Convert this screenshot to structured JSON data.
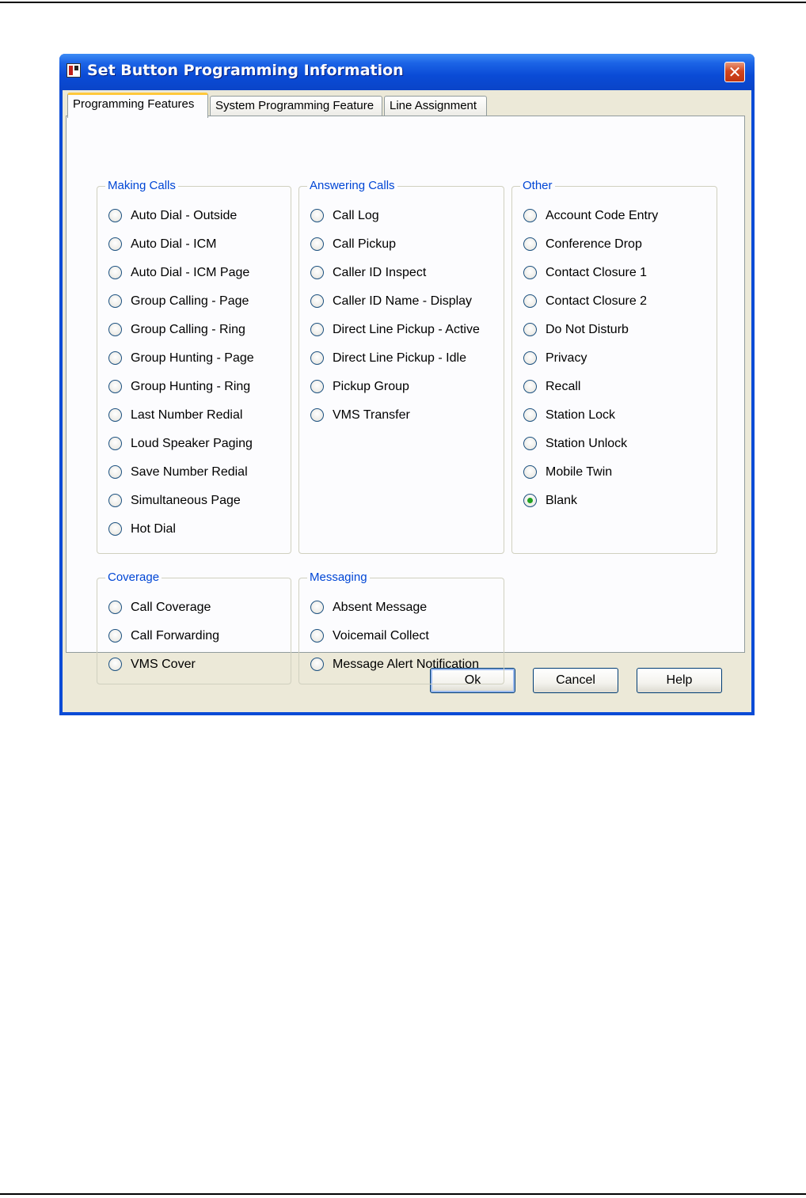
{
  "window": {
    "title": "Set Button Programming Information",
    "close_glyph": "✕"
  },
  "tabs": [
    {
      "label": "Programming Features",
      "selected": true
    },
    {
      "label": "System Programming Feature",
      "selected": false
    },
    {
      "label": "Line Assignment",
      "selected": false
    }
  ],
  "groups": {
    "making_calls": {
      "title": "Making Calls",
      "options": [
        "Auto Dial - Outside",
        "Auto Dial - ICM",
        "Auto Dial - ICM Page",
        "Group Calling - Page",
        "Group Calling - Ring",
        "Group Hunting - Page",
        "Group Hunting - Ring",
        "Last Number Redial",
        "Loud Speaker Paging",
        "Save Number Redial",
        "Simultaneous Page",
        "Hot Dial"
      ]
    },
    "answering_calls": {
      "title": "Answering Calls",
      "options": [
        "Call Log",
        "Call Pickup",
        "Caller ID Inspect",
        "Caller ID Name - Display",
        "Direct Line Pickup - Active",
        "Direct Line Pickup - Idle",
        "Pickup Group",
        "VMS Transfer"
      ]
    },
    "other": {
      "title": "Other",
      "options": [
        "Account Code Entry",
        "Conference Drop",
        "Contact Closure 1",
        "Contact Closure 2",
        "Do Not Disturb",
        "Privacy",
        "Recall",
        "Station Lock",
        "Station Unlock",
        "Mobile Twin",
        "Blank"
      ],
      "selected": "Blank"
    },
    "coverage": {
      "title": "Coverage",
      "options": [
        "Call Coverage",
        "Call Forwarding",
        "VMS Cover"
      ]
    },
    "messaging": {
      "title": "Messaging",
      "options": [
        "Absent Message",
        "Voicemail Collect",
        "Message Alert Notification"
      ]
    }
  },
  "buttons": {
    "ok": "Ok",
    "cancel": "Cancel",
    "help": "Help"
  }
}
